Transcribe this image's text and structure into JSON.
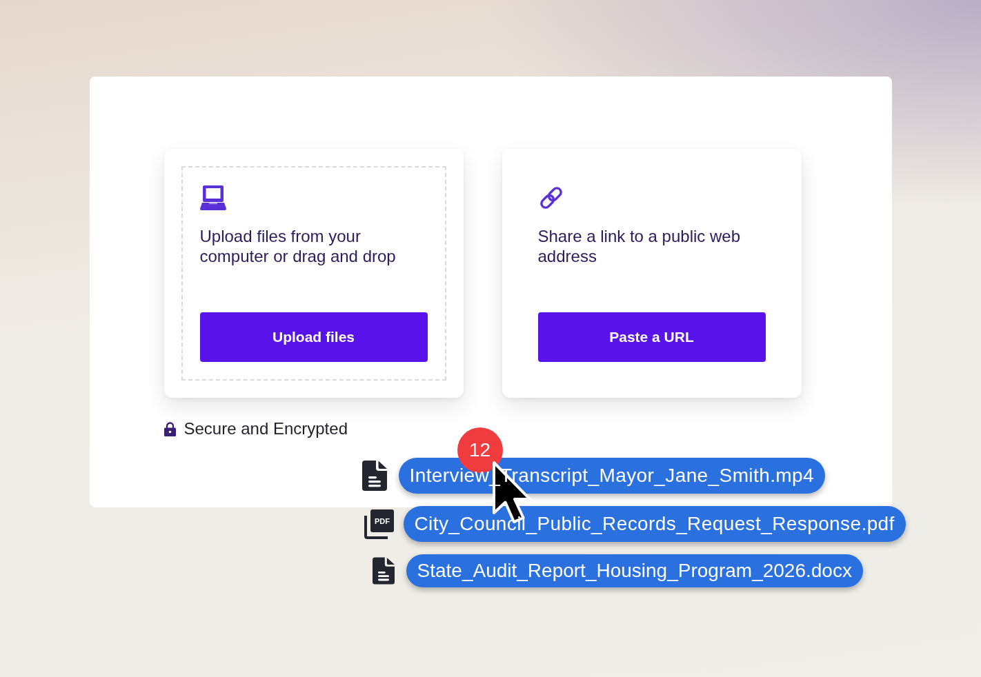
{
  "upload_options": [
    {
      "kind": "upload",
      "description": "Upload files from your computer or drag and drop",
      "button": "Upload files"
    },
    {
      "kind": "link",
      "description": "Share a link to a public web address",
      "button": "Paste a URL"
    }
  ],
  "security_note": "Secure and Encrypted",
  "dragged_files": {
    "count_badge": "12",
    "files": [
      {
        "kind": "document",
        "name": "Interview_Transcript_Mayor_Jane_Smith.mp4"
      },
      {
        "kind": "pdf",
        "icon_text": "PDF",
        "name": "City_Council_Public_Records_Request_Response.pdf"
      },
      {
        "kind": "document",
        "name": "State_Audit_Report_Housing_Program_2026.docx"
      }
    ]
  }
}
